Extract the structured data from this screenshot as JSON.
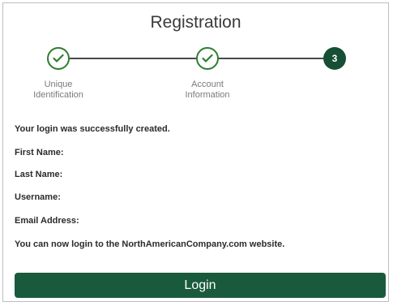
{
  "header": {
    "title": "Registration"
  },
  "stepper": {
    "steps": [
      {
        "label_line1": "Unique",
        "label_line2": "Identification",
        "status": "completed"
      },
      {
        "label_line1": "Account",
        "label_line2": "Information",
        "status": "completed"
      },
      {
        "number": "3",
        "status": "current"
      }
    ],
    "completed_color": "#2e7d32",
    "current_color": "#164f35"
  },
  "content": {
    "success_message": "Your login was successfully created.",
    "first_name_label": "First Name:",
    "last_name_label": "Last Name:",
    "username_label": "Username:",
    "email_label": "Email Address:",
    "info_text": "You can now login to the NorthAmericanCompany.com website."
  },
  "actions": {
    "login_label": "Login",
    "login_color": "#1a5a3c"
  }
}
